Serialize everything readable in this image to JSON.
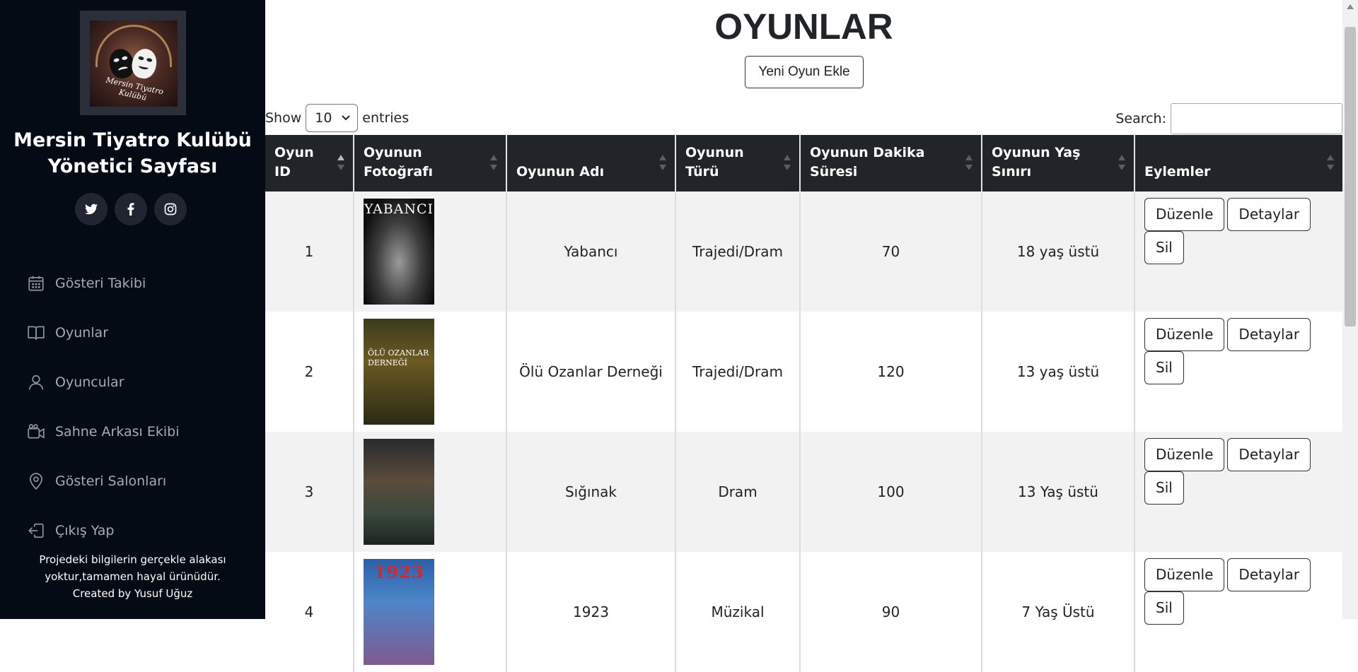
{
  "sidebar": {
    "logo_text": "Mersin Tiyatro Kulübü",
    "title_line1": "Mersin Tiyatro Kulübü",
    "title_line2": "Yönetici Sayfası",
    "social": [
      "twitter-icon",
      "facebook-icon",
      "instagram-icon"
    ],
    "nav": [
      {
        "label": "Gösteri Takibi",
        "icon": "calendar-icon"
      },
      {
        "label": "Oyunlar",
        "icon": "book-icon"
      },
      {
        "label": "Oyuncular",
        "icon": "person-icon"
      },
      {
        "label": "Sahne Arkası Ekibi",
        "icon": "camera-icon"
      },
      {
        "label": "Gösteri Salonları",
        "icon": "location-pin-icon"
      },
      {
        "label": "Çıkış Yap",
        "icon": "logout-icon"
      }
    ],
    "footer_line1": "Projedeki bilgilerin gerçekle alakası",
    "footer_line2": "yoktur,tamamen hayal ürünüdür.",
    "footer_line3": "Created by Yusuf Uğuz"
  },
  "main": {
    "title": "OYUNLAR",
    "add_button": "Yeni Oyun Ekle",
    "show_label": "Show",
    "entries_value": "10",
    "entries_label": "entries",
    "search_label": "Search:",
    "search_value": ""
  },
  "table": {
    "headers": [
      {
        "line1": "Oyun",
        "line2": "ID"
      },
      {
        "line1": "Oyunun",
        "line2": "Fotoğrafı"
      },
      {
        "line1": "",
        "line2": "Oyunun Adı"
      },
      {
        "line1": "Oyunun",
        "line2": "Türü"
      },
      {
        "line1": "Oyunun Dakika",
        "line2": "Süresi"
      },
      {
        "line1": "Oyunun Yaş",
        "line2": "Sınırı"
      },
      {
        "line1": "",
        "line2": "Eylemler"
      }
    ],
    "rows": [
      {
        "id": "1",
        "poster_text": "YABANCI",
        "name": "Yabancı",
        "genre": "Trajedi/Dram",
        "duration": "70",
        "age": "18 yaş üstü"
      },
      {
        "id": "2",
        "poster_text": "ÖLÜ OZANLAR DERNEĞİ",
        "name": "Ölü Ozanlar Derneği",
        "genre": "Trajedi/Dram",
        "duration": "120",
        "age": "13 yaş üstü"
      },
      {
        "id": "3",
        "poster_text": "",
        "name": "Sığınak",
        "genre": "Dram",
        "duration": "100",
        "age": "13 Yaş üstü"
      },
      {
        "id": "4",
        "poster_text": "1923",
        "name": "1923",
        "genre": "Müzikal",
        "duration": "90",
        "age": "7 Yaş Üstü"
      }
    ],
    "actions": {
      "edit": "Düzenle",
      "details": "Detaylar",
      "delete": "Sil"
    }
  }
}
